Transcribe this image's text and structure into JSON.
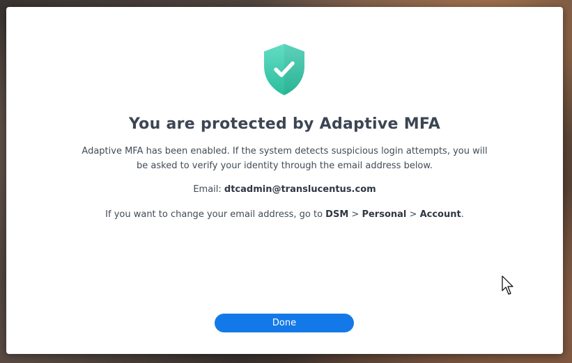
{
  "dialog": {
    "title": "You are protected by Adaptive MFA",
    "description": "Adaptive MFA has been enabled. If the system detects suspicious login attempts, you will be asked to verify your identity through the email address below.",
    "email_label": "Email:",
    "email_value": "dtcadmin@translucentus.com",
    "change_prefix": "If you want to change your email address, go to",
    "path": [
      "DSM",
      "Personal",
      "Account"
    ],
    "path_separator": ">",
    "change_suffix": ".",
    "done_label": "Done"
  },
  "icons": {
    "shield": "shield-check-icon",
    "cursor": "mouse-pointer-icon"
  },
  "colors": {
    "shield_top": "#5fdcc3",
    "shield_bottom": "#2cbf9f",
    "primary_button": "#1479e8",
    "title_text": "#3c4553"
  }
}
